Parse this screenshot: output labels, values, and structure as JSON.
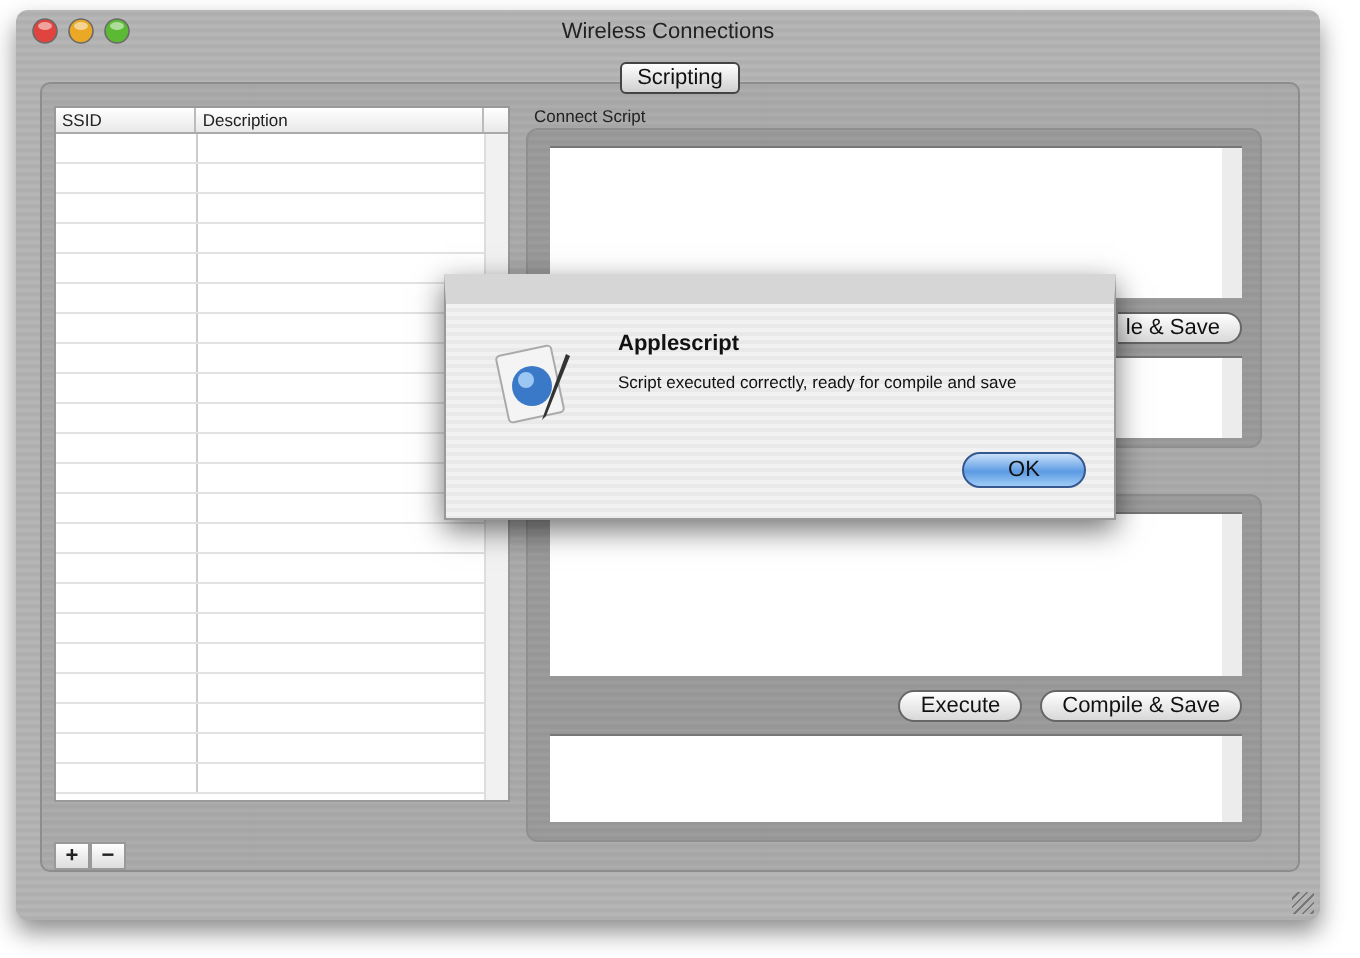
{
  "window": {
    "title": "Wireless Connections"
  },
  "tabs": [
    {
      "label": "Scripting",
      "selected": true
    }
  ],
  "table": {
    "columns": [
      "SSID",
      "Description"
    ]
  },
  "table_buttons": [
    "+",
    "−"
  ],
  "connect_script": {
    "label": "Connect Script",
    "upper_buttons": [
      "le & Save"
    ],
    "lower_buttons": [
      "Execute",
      "Compile & Save"
    ]
  },
  "dialog": {
    "title": "Applescript",
    "message": "Script executed correctly, ready for compile and save",
    "button": "OK"
  }
}
